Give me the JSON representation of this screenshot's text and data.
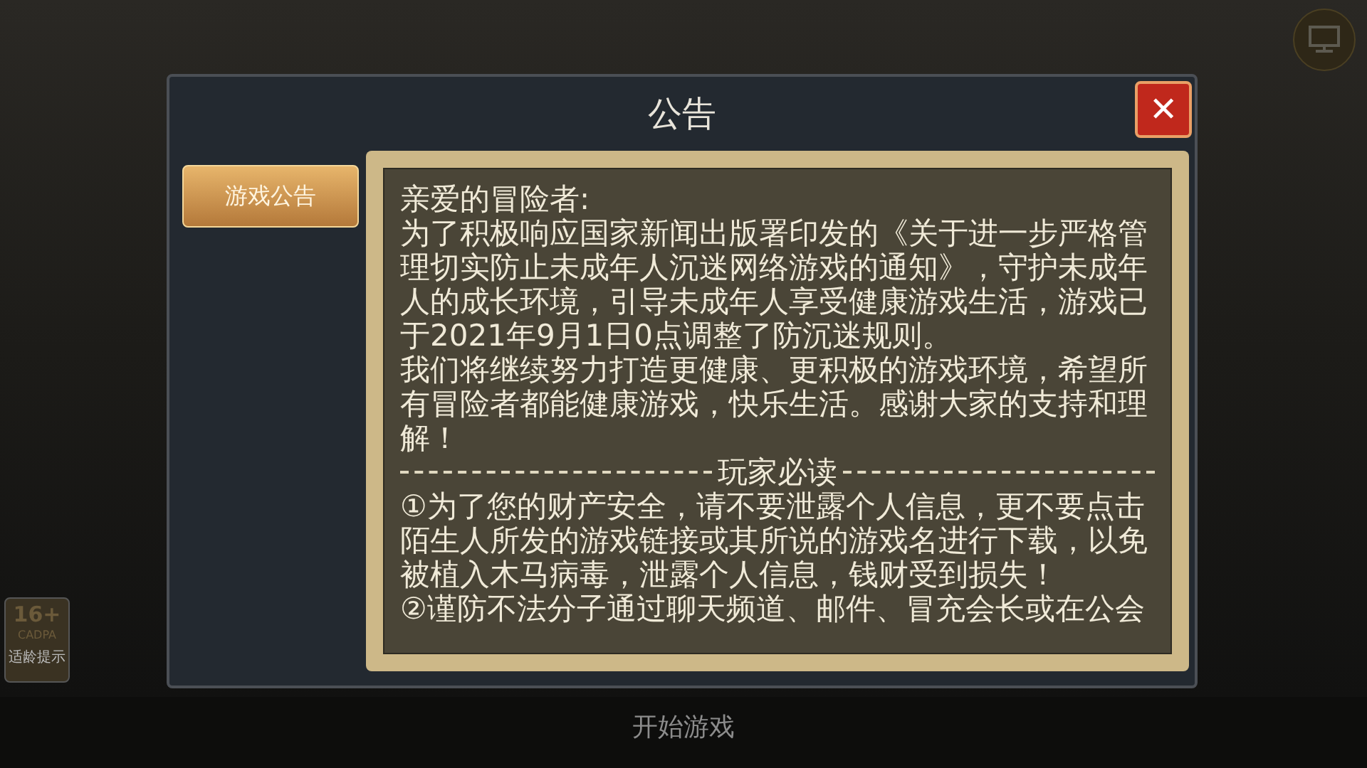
{
  "dialog": {
    "title": "公告",
    "close_label": "✕"
  },
  "tabs": [
    {
      "label": "游戏公告",
      "selected": true
    }
  ],
  "notice": {
    "greeting": "亲爱的冒险者:",
    "paragraphs": [
      "为了积极响应国家新闻出版署印发的《关于进一步严格管理切实防止未成年人沉迷网络游戏的通知》，守护未成年人的成长环境，引导未成年人享受健康游戏生活，游戏已于2021年9月1日0点调整了防沉迷规则。",
      "我们将继续努力打造更健康、更积极的游戏环境，希望所有冒险者都能健康游戏，快乐生活。感谢大家的支持和理解！"
    ],
    "section_title": "玩家必读",
    "items": [
      "①为了您的财产安全，请不要泄露个人信息，更不要点击陌生人所发的游戏链接或其所说的游戏名进行下载，以免被植入木马病毒，泄露个人信息，钱财受到损失！",
      "②谨防不法分子通过聊天频道、邮件、冒充会长或在公会"
    ]
  },
  "age_badge": {
    "rating": "16+",
    "org": "CADPA",
    "caption": "适龄提示"
  },
  "start_label": "开始游戏"
}
